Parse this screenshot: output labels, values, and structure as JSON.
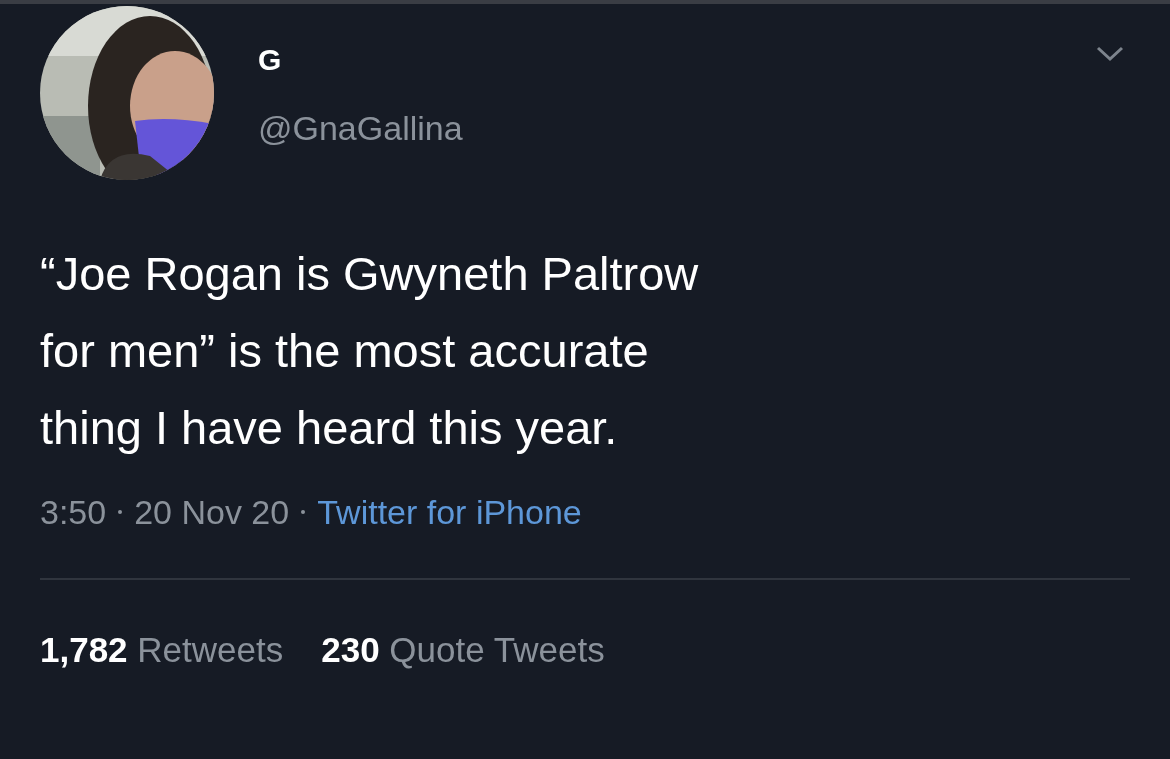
{
  "author": {
    "name": "G",
    "handle": "@GnaGallina"
  },
  "tweet_text": "“Joe Rogan is Gwyneth Paltrow\nfor men” is the most accurate\nthing I have heard this year.",
  "meta": {
    "time": "3:50",
    "date": "20 Nov 20",
    "source": "Twitter for iPhone"
  },
  "stats": [
    {
      "count": "1,782",
      "label": "Retweets"
    },
    {
      "count": "230",
      "label": "Quote Tweets"
    }
  ]
}
